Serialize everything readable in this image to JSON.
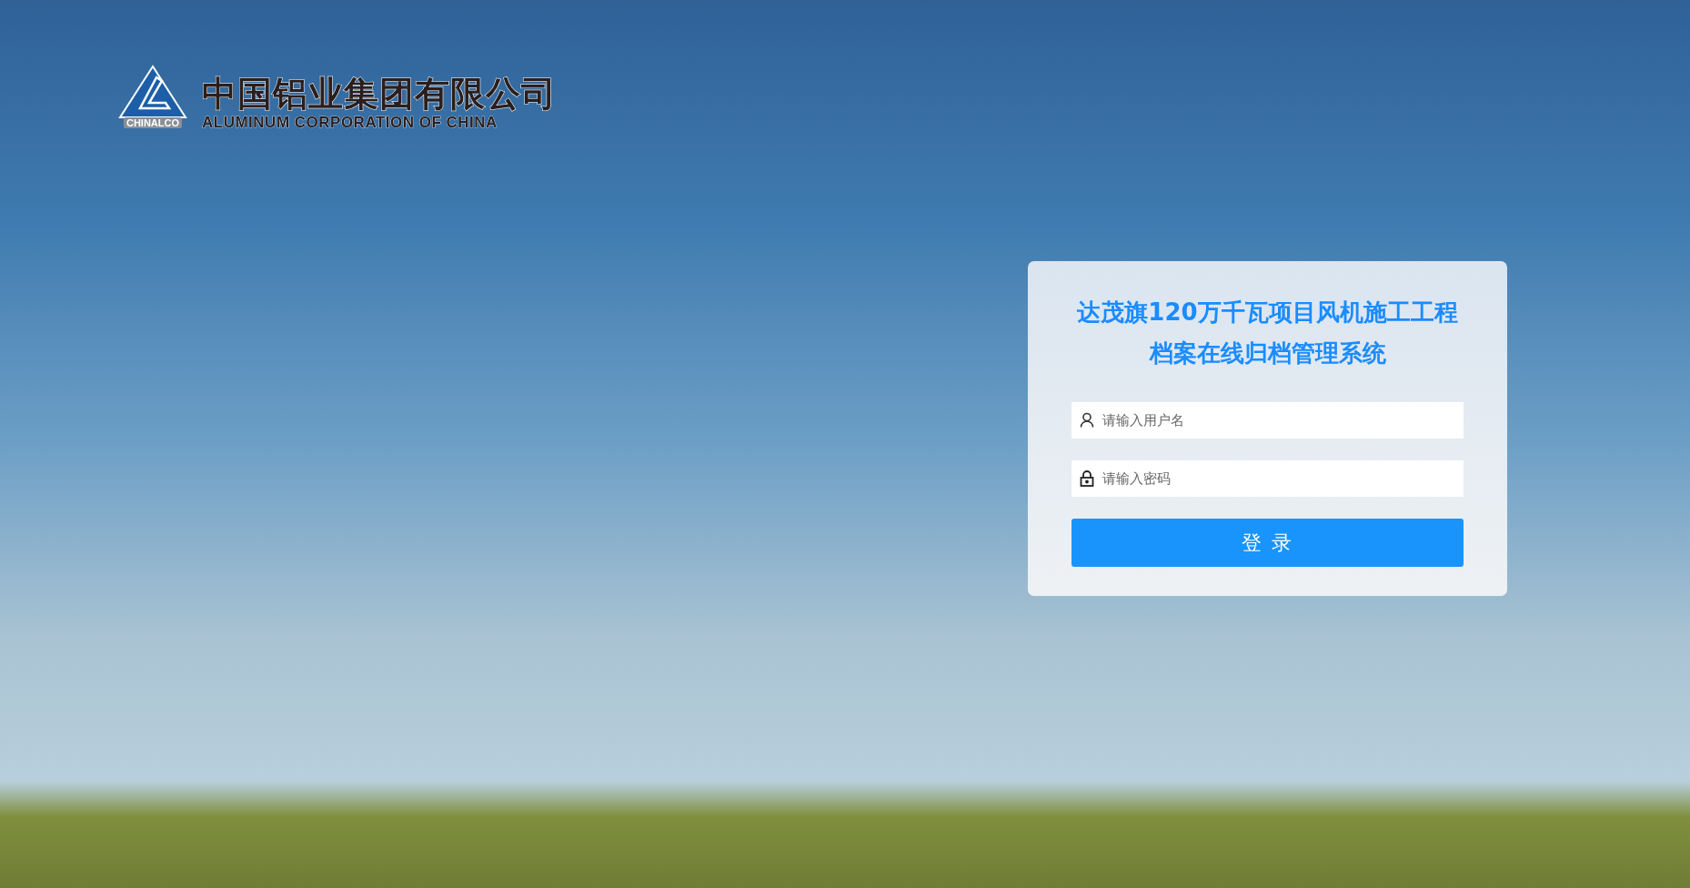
{
  "logo": {
    "mark_text": "CHINALCO",
    "chinese_name": "中国铝业集团有限公司",
    "english_name": "ALUMINUM CORPORATION OF CHINA"
  },
  "login": {
    "title_lines": [
      "达茂旗120万千瓦项目风机施工工程",
      "档案在线归档管理系统"
    ],
    "username": {
      "placeholder": "请输入用户名"
    },
    "password": {
      "placeholder": "请输入密码"
    },
    "button": "登 录"
  }
}
